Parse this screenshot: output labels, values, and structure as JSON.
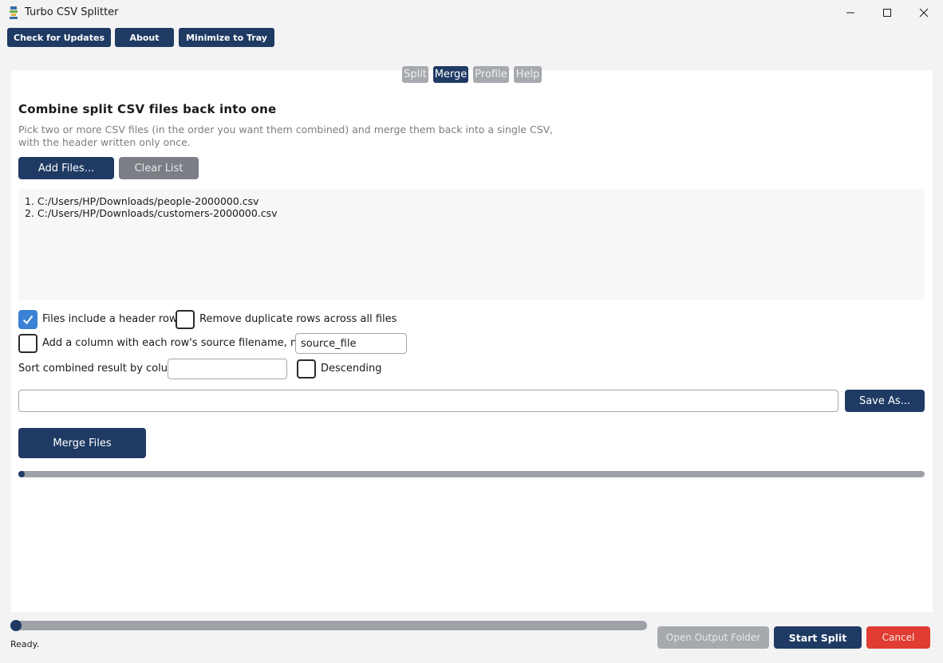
{
  "window": {
    "title": "Turbo CSV Splitter"
  },
  "toolbar": {
    "check_updates": "Check for Updates",
    "about": "About",
    "minimize_tray": "Minimize to Tray"
  },
  "tabs": [
    {
      "label": "Split",
      "active": false
    },
    {
      "label": "Merge",
      "active": true
    },
    {
      "label": "Profile",
      "active": false
    },
    {
      "label": "Help",
      "active": false
    }
  ],
  "merge": {
    "heading": "Combine split CSV files back into one",
    "description": "Pick two or more CSV files (in the order you want them combined) and merge them back into a single CSV, with the header written only once.",
    "add_files": "Add Files...",
    "clear_list": "Clear List",
    "files": [
      "1. C:/Users/HP/Downloads/people-2000000.csv",
      "2. C:/Users/HP/Downloads/customers-2000000.csv"
    ],
    "opt_header": {
      "label": "Files include a header row",
      "checked": true
    },
    "opt_dedupe": {
      "label": "Remove duplicate rows across all files",
      "checked": false
    },
    "opt_source_col": {
      "label": "Add a column with each row's source filename, named:",
      "checked": false
    },
    "source_col_value": "source_file",
    "sort_label": "Sort combined result by column:",
    "sort_value": "",
    "opt_descending": {
      "label": "Descending",
      "checked": false
    },
    "output_path": "",
    "save_as": "Save As...",
    "merge_button": "Merge Files",
    "merge_progress": 0
  },
  "footer": {
    "progress": 0,
    "status": "Ready.",
    "open_folder": "Open Output Folder",
    "start_split": "Start Split",
    "cancel": "Cancel"
  },
  "colors": {
    "primary": "#1f3b64",
    "cancel": "#e03c31",
    "checkbox_on": "#3b82d6"
  }
}
